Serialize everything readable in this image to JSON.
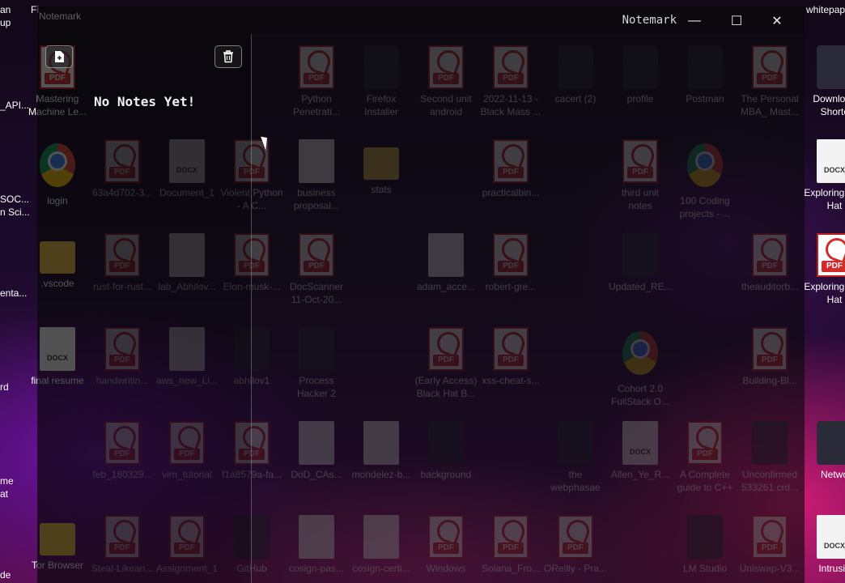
{
  "app": {
    "window_title": "Notemark",
    "ghost_title": "Notemark",
    "empty_state": "No Notes Yet!",
    "buttons": {
      "new_note": "new note",
      "delete_note": "delete note",
      "minimize": "—",
      "maximize": "☐",
      "close": "✕"
    }
  },
  "desktop": {
    "top_partial_labels": [
      "an",
      "Fi",
      "whitepap"
    ],
    "left_edge": [
      "up",
      "_API...",
      "SOC...",
      "n Sci...",
      "enta...",
      "rd",
      "me",
      "at",
      "de"
    ],
    "icons": [
      {
        "label": "Mastering Machine Le...",
        "kind": "pdf"
      },
      {
        "label": "Python Penetrati...",
        "kind": "pdf"
      },
      {
        "label": "Firefox Installer",
        "kind": "generic"
      },
      {
        "label": "Second unit android",
        "kind": "pdf"
      },
      {
        "label": "2022-11-13 - Black Mass ...",
        "kind": "pdf"
      },
      {
        "label": "cacert (2)",
        "kind": "generic"
      },
      {
        "label": "profile",
        "kind": "generic"
      },
      {
        "label": "Postman",
        "kind": "generic"
      },
      {
        "label": "The Personal MBA_ Mast...",
        "kind": "pdf"
      },
      {
        "label": "Download Shortc",
        "kind": "generic"
      },
      {
        "label": "login",
        "kind": "chrome"
      },
      {
        "label": "63a4d702-3...",
        "kind": "pdf"
      },
      {
        "label": "Document_1",
        "kind": "docx"
      },
      {
        "label": "Violent Python - A C...",
        "kind": "pdf"
      },
      {
        "label": "business proposal...",
        "kind": "doc"
      },
      {
        "label": "stats",
        "kind": "folder"
      },
      {
        "label": "practicalbin...",
        "kind": "pdf"
      },
      {
        "label": "third unit notes",
        "kind": "pdf"
      },
      {
        "label": "100 Coding projects - ...",
        "kind": "chrome"
      },
      {
        "label": "Exploring Red Hat",
        "kind": "docx"
      },
      {
        "label": ".vscode",
        "kind": "folder"
      },
      {
        "label": "rust-for-rust...",
        "kind": "pdf"
      },
      {
        "label": "lab_Abhilov...",
        "kind": "doc"
      },
      {
        "label": "Elon-musk-...",
        "kind": "pdf"
      },
      {
        "label": "DocScanner 11-Oct-20...",
        "kind": "pdf"
      },
      {
        "label": "adam_acce...",
        "kind": "doc"
      },
      {
        "label": "robert-gre...",
        "kind": "pdf"
      },
      {
        "label": "Updated_RE...",
        "kind": "generic"
      },
      {
        "label": "theauditorb...",
        "kind": "pdf"
      },
      {
        "label": "Exploring Red Hat",
        "kind": "pdf"
      },
      {
        "label": "final resume",
        "kind": "docx"
      },
      {
        "label": "handwritin...",
        "kind": "pdf"
      },
      {
        "label": "aws_new_Li...",
        "kind": "doc"
      },
      {
        "label": "abhilov1",
        "kind": "generic"
      },
      {
        "label": "Process Hacker 2",
        "kind": "generic"
      },
      {
        "label": "(Early Access) Black Hat B...",
        "kind": "pdf"
      },
      {
        "label": "xss-cheat-s...",
        "kind": "pdf"
      },
      {
        "label": "Cohort 2.0 FullStack O...",
        "kind": "chrome"
      },
      {
        "label": "Building-Bl...",
        "kind": "pdf"
      },
      {
        "label": "feb_180329...",
        "kind": "pdf"
      },
      {
        "label": "vim_tutorial",
        "kind": "pdf"
      },
      {
        "label": "f1a8579a-fa...",
        "kind": "pdf"
      },
      {
        "label": "DoD_CAs...",
        "kind": "doc"
      },
      {
        "label": "mondelez-b...",
        "kind": "doc"
      },
      {
        "label": "background",
        "kind": "generic"
      },
      {
        "label": "the webphasae",
        "kind": "generic"
      },
      {
        "label": "Allen_Ye_R...",
        "kind": "docx"
      },
      {
        "label": "A Complete guide to C++",
        "kind": "pdf"
      },
      {
        "label": "Unconfirmed 533261.crd...",
        "kind": "generic"
      },
      {
        "label": "Netwo",
        "kind": "generic"
      },
      {
        "label": "Tor Browser",
        "kind": "folder"
      },
      {
        "label": "Steal-Likean...",
        "kind": "pdf"
      },
      {
        "label": "Assignment_1",
        "kind": "pdf"
      },
      {
        "label": "GitHub",
        "kind": "generic"
      },
      {
        "label": "cosign-pas...",
        "kind": "doc"
      },
      {
        "label": "cosign-certi...",
        "kind": "doc"
      },
      {
        "label": "Windows",
        "kind": "pdf"
      },
      {
        "label": "Solana_Fro...",
        "kind": "pdf"
      },
      {
        "label": "OReilly - Pra...",
        "kind": "pdf"
      },
      {
        "label": "LM Studio",
        "kind": "generic"
      },
      {
        "label": "Uniswap-V3...",
        "kind": "pdf"
      },
      {
        "label": "Intrusio",
        "kind": "docx"
      }
    ]
  },
  "colors": {
    "accent_pdf": "#d32a2a",
    "folder": "#e8c048"
  }
}
